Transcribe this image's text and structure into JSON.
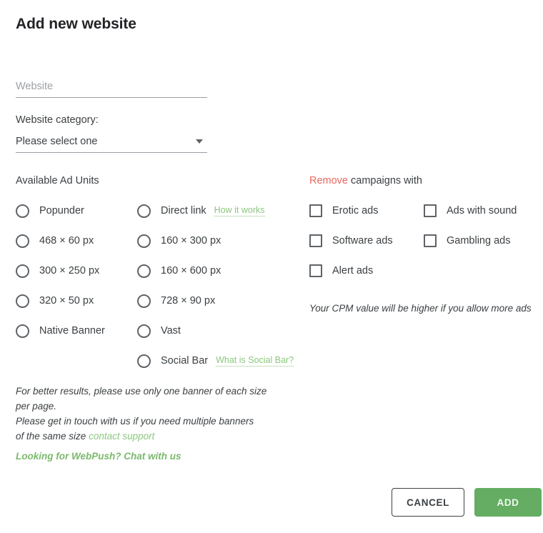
{
  "dialog": {
    "title": "Add new website"
  },
  "website_field": {
    "name": "website",
    "value": "",
    "placeholder": "Website"
  },
  "category": {
    "label": "Website category:",
    "selected": "Please select one",
    "caret_icon": "chevron-down-icon"
  },
  "ad_units": {
    "heading": "Available Ad Units",
    "left_column": [
      {
        "label": "Popunder",
        "checked": false
      },
      {
        "label": "468 × 60 px",
        "checked": false
      },
      {
        "label": "300 × 250 px",
        "checked": false
      },
      {
        "label": "320 × 50 px",
        "checked": false
      },
      {
        "label": "Native Banner",
        "checked": false
      }
    ],
    "right_column": [
      {
        "label": "Direct link",
        "checked": false,
        "help_link": "How it works"
      },
      {
        "label": "160 × 300 px",
        "checked": false,
        "help_link": ""
      },
      {
        "label": "160 × 600 px",
        "checked": false,
        "help_link": ""
      },
      {
        "label": "728 × 90 px",
        "checked": false,
        "help_link": ""
      },
      {
        "label": "Vast",
        "checked": false,
        "help_link": ""
      },
      {
        "label": "Social Bar",
        "checked": false,
        "help_link": "What is Social Bar?"
      }
    ]
  },
  "remove_campaigns": {
    "heading_accent": "Remove",
    "heading_rest": " campaigns with",
    "items": [
      {
        "label": "Erotic ads",
        "checked": false
      },
      {
        "label": "Ads with sound",
        "checked": false
      },
      {
        "label": "Software ads",
        "checked": false
      },
      {
        "label": "Gambling ads",
        "checked": false
      },
      {
        "label": "Alert ads",
        "checked": false
      }
    ],
    "cpm_note": "Your CPM value will be higher if you allow more ads"
  },
  "footer_notes": {
    "line1": "For better results, please use only one banner of each size",
    "line2": "per page.",
    "line3": "Please get in touch with us if you need multiple banners",
    "line4_text": "of the same size ",
    "line4_link": "contact support",
    "webpush_link": "Looking for WebPush? Chat with us"
  },
  "actions": {
    "cancel_label": "CANCEL",
    "add_label": "ADD"
  },
  "colors": {
    "accent_green": "#64ad62",
    "link_green": "#8cc77f",
    "webpush_green": "#7ab96c",
    "remove_red": "#e8685f",
    "text": "#3c4043",
    "muted": "#9aa0a6"
  }
}
